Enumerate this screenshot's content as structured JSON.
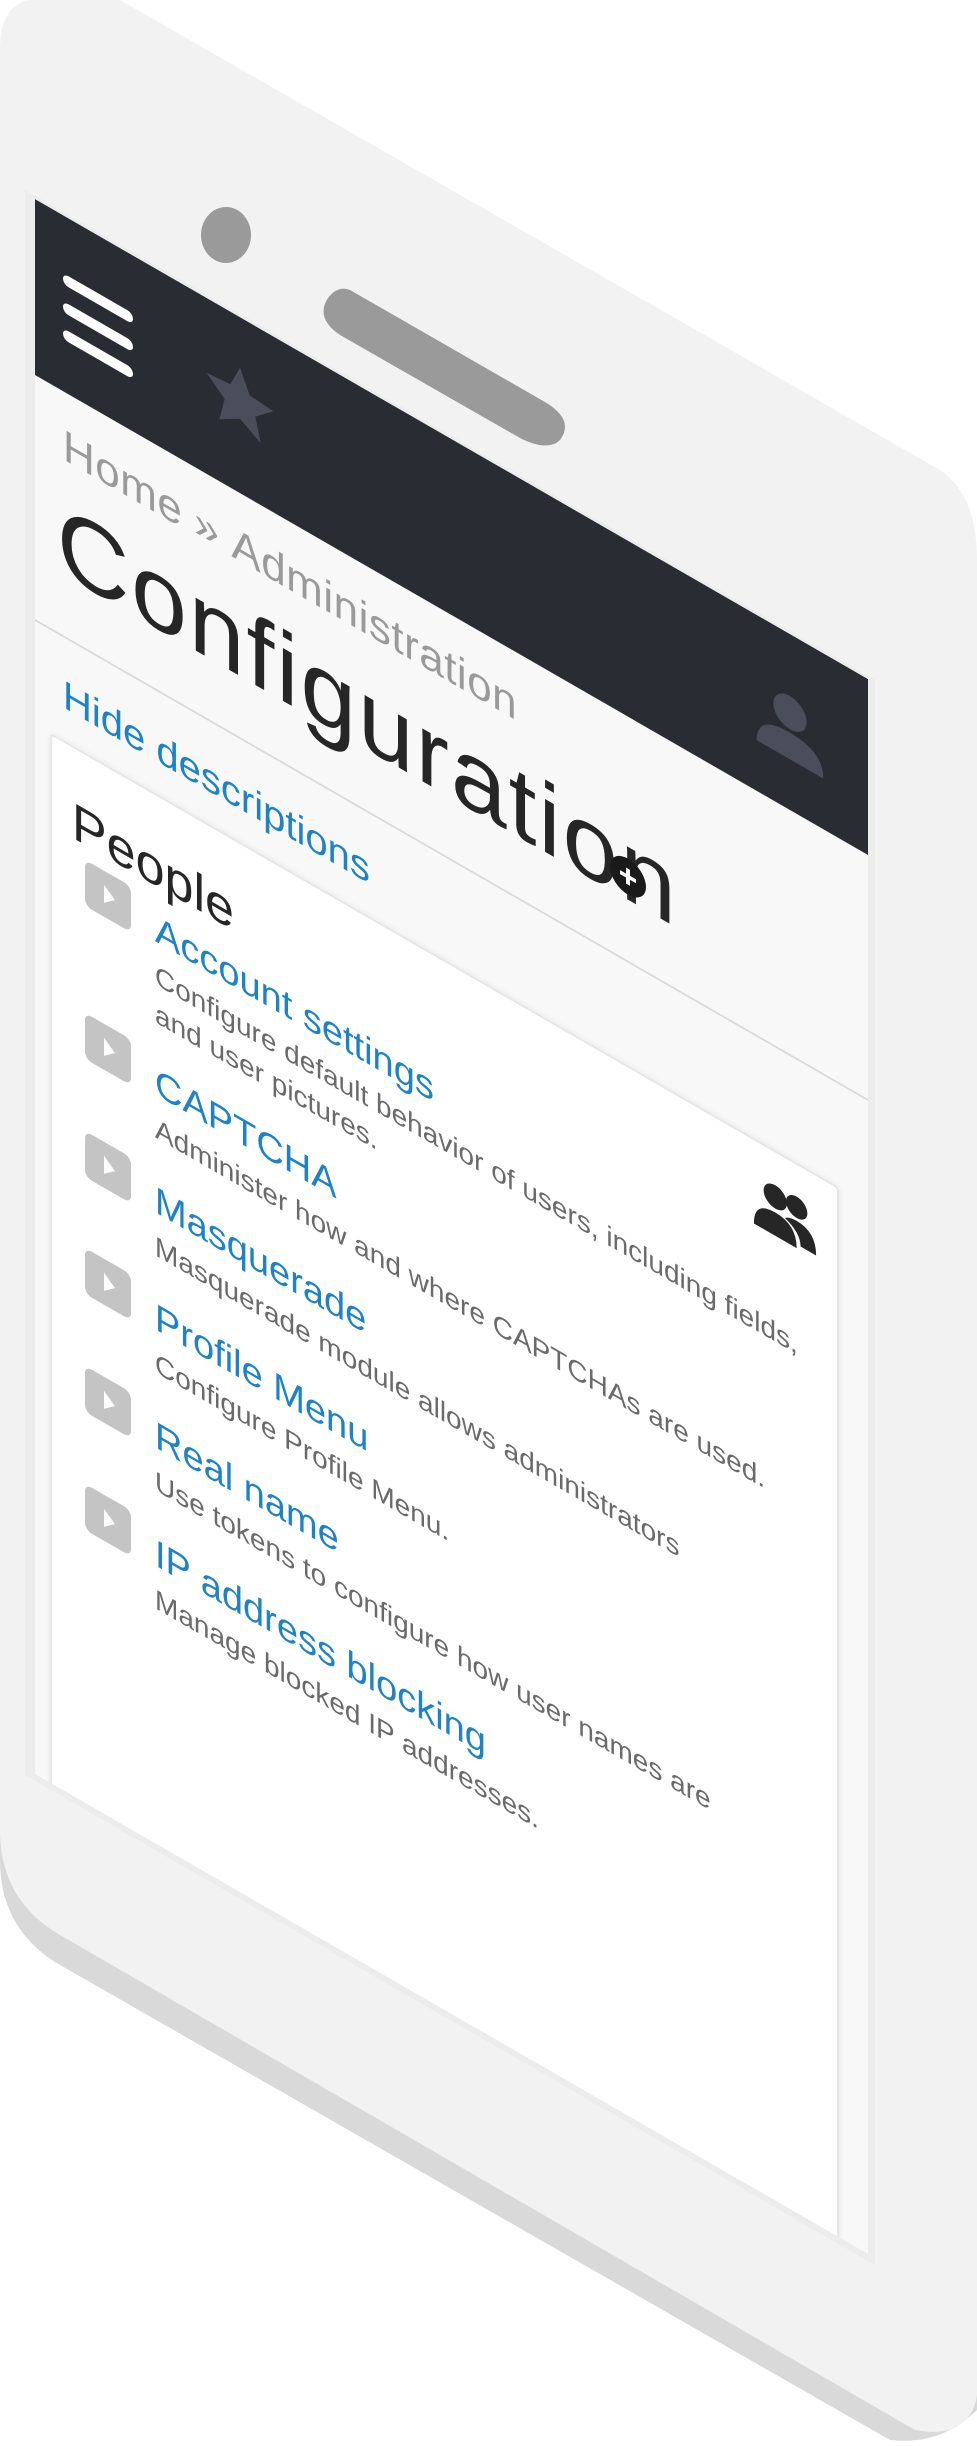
{
  "breadcrumb": {
    "home": "Home",
    "separator": "»",
    "administration": "Administration"
  },
  "page": {
    "title": "Configuration"
  },
  "actions": {
    "hide_descriptions": "Hide descriptions"
  },
  "section": {
    "title": "People",
    "icon": "people-icon",
    "items": [
      {
        "label": "Account settings",
        "description": "Configure default behavior of users, including fields, and user pictures."
      },
      {
        "label": "CAPTCHA",
        "description": "Administer how and where CAPTCHAs are used."
      },
      {
        "label": "Masquerade",
        "description": "Masquerade module allows administrators"
      },
      {
        "label": "Profile Menu",
        "description": "Configure Profile Menu."
      },
      {
        "label": "Real name",
        "description": "Use tokens to configure how user names are"
      },
      {
        "label": "IP address blocking",
        "description": "Manage blocked IP addresses."
      }
    ]
  },
  "toolbar": {
    "menu_icon": "hamburger-menu-icon",
    "shortcuts_icon": "star-icon",
    "user_icon": "user-avatar-icon"
  },
  "colors": {
    "toolbar_bg": "#2a2c33",
    "link": "#1d82c8",
    "title": "#262626",
    "muted": "#9a9a9a",
    "phone_body": "#f2f2f2"
  }
}
